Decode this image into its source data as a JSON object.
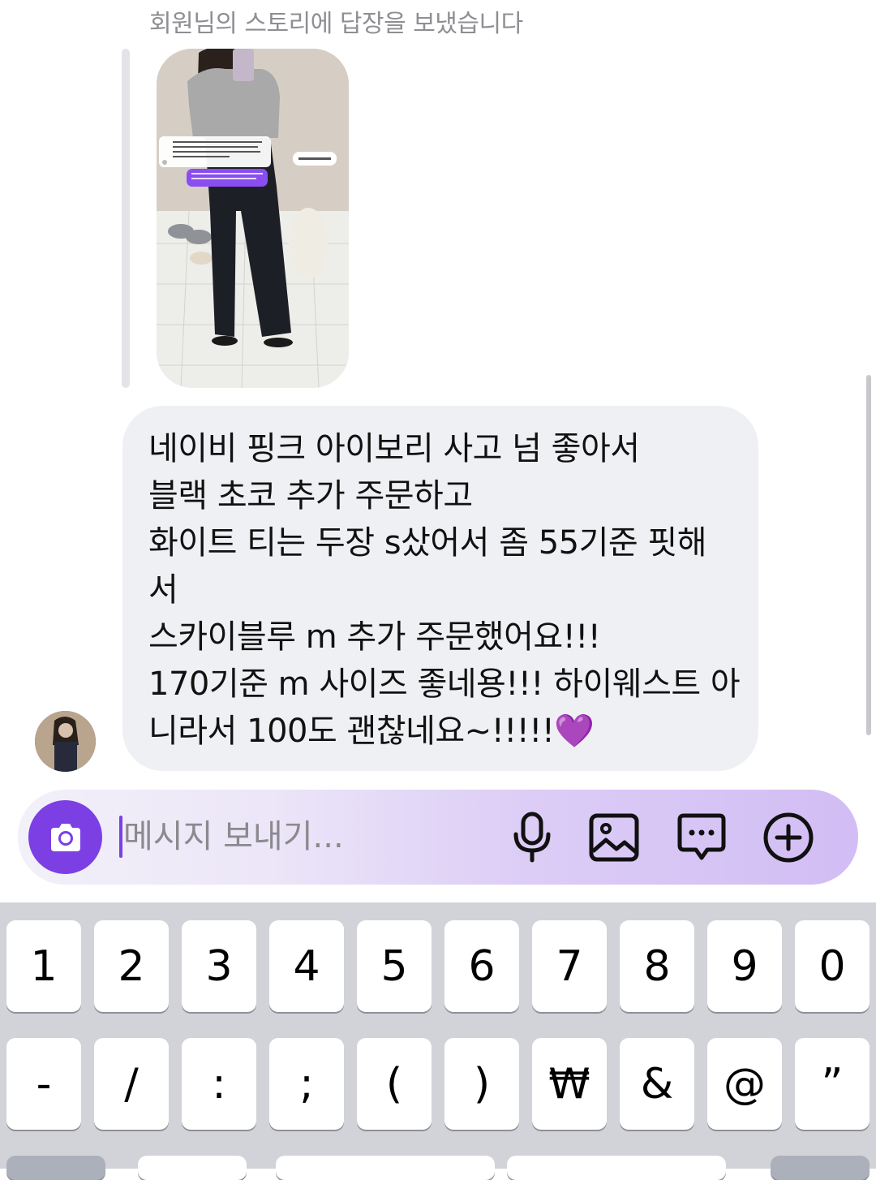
{
  "story_reply": {
    "caption": "회원님의 스토리에 답장을 보냈습니다"
  },
  "message": {
    "lines": [
      "네이비 핑크 아이보리 사고 넘 좋아서",
      "블랙 초코 추가 주문하고",
      "화이트 티는 두장 s샀어서 좀 55기준 핏해",
      "서",
      "스카이블루 m 추가 주문했어요!!!",
      "170기준 m 사이즈 좋네용!!! 하이웨스트 아",
      "니라서 100도 괜찮네요~!!!!!💜"
    ]
  },
  "composer": {
    "placeholder": "메시지 보내기...",
    "icons": [
      "camera-icon",
      "microphone-icon",
      "gallery-icon",
      "sticker-chat-icon",
      "plus-icon"
    ],
    "accent_color": "#7b3fe4"
  },
  "keyboard": {
    "row1": [
      "1",
      "2",
      "3",
      "4",
      "5",
      "6",
      "7",
      "8",
      "9",
      "0"
    ],
    "row2": [
      "-",
      "/",
      ":",
      ";",
      "(",
      ")",
      "₩",
      "&",
      "@",
      "”"
    ]
  }
}
